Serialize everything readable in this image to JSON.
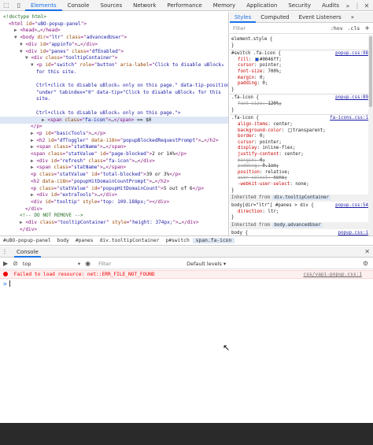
{
  "toolbar": {
    "tabs": [
      "Elements",
      "Console",
      "Sources",
      "Network",
      "Performance",
      "Memory",
      "Application",
      "Security",
      "Audits"
    ],
    "more": "»",
    "menu": "⋮",
    "close": "✕"
  },
  "elements": {
    "lines": [
      {
        "parts": [
          [
            "cm",
            "<!doctype html>"
          ]
        ]
      },
      {
        "parts": [
          [
            "t",
            "<html "
          ],
          [
            "a",
            "id"
          ],
          [
            "t",
            "=\""
          ],
          [
            "v",
            "uBO-popup-panel"
          ],
          [
            "t",
            "\">"
          ]
        ]
      },
      {
        "parts": [
          [
            "tri",
            "▶ "
          ],
          [
            "t",
            "<head>"
          ],
          [
            "tx",
            "…"
          ],
          [
            "t",
            "</head>"
          ]
        ]
      },
      {
        "parts": [
          [
            "tri",
            "▼ "
          ],
          [
            "t",
            "<body "
          ],
          [
            "a",
            "dir"
          ],
          [
            "t",
            "=\""
          ],
          [
            "v",
            "ltr"
          ],
          [
            "t",
            "\" "
          ],
          [
            "a",
            "class"
          ],
          [
            "t",
            "=\""
          ],
          [
            "v",
            "advancedUser"
          ],
          [
            "t",
            "\">"
          ]
        ]
      },
      {
        "parts": [
          [
            "tri",
            "▼ "
          ],
          [
            "t",
            "<div "
          ],
          [
            "a",
            "id"
          ],
          [
            "t",
            "=\""
          ],
          [
            "v",
            "appinfo"
          ],
          [
            "t",
            "\">"
          ],
          [
            "tx",
            "…"
          ],
          [
            "t",
            "</div>"
          ]
        ]
      },
      {
        "parts": [
          [
            "tri",
            "▼ "
          ],
          [
            "t",
            "<div "
          ],
          [
            "a",
            "id"
          ],
          [
            "t",
            "=\""
          ],
          [
            "v",
            "panes"
          ],
          [
            "t",
            "\" "
          ],
          [
            "a",
            "class"
          ],
          [
            "t",
            "=\""
          ],
          [
            "v",
            "dfEnabled"
          ],
          [
            "t",
            "\">"
          ]
        ]
      },
      {
        "parts": [
          [
            "tri",
            "▼ "
          ],
          [
            "t",
            "<div "
          ],
          [
            "a",
            "class"
          ],
          [
            "t",
            "=\""
          ],
          [
            "v",
            "tooltipContainer"
          ],
          [
            "t",
            "\">"
          ]
        ]
      },
      {
        "parts": [
          [
            "tri",
            "▼ "
          ],
          [
            "t",
            "<p "
          ],
          [
            "a",
            "id"
          ],
          [
            "t",
            "=\""
          ],
          [
            "v",
            "switch"
          ],
          [
            "t",
            "\" "
          ],
          [
            "a",
            "role"
          ],
          [
            "t",
            "=\""
          ],
          [
            "v",
            "button"
          ],
          [
            "t",
            "\" "
          ],
          [
            "a",
            "aria-label"
          ],
          [
            "t",
            "=\""
          ],
          [
            "v",
            "Click to disable uBlock₀"
          ]
        ]
      },
      {
        "parts": [
          [
            "v",
            "for this site."
          ]
        ]
      },
      {
        "parts": []
      },
      {
        "parts": [
          [
            "v",
            "Ctrl+click to disable uBlock₀ only on this page.\" data-tip-position="
          ]
        ]
      },
      {
        "parts": [
          [
            "v",
            "\"under\" tabindex=\"0\" data-tip=\"Click to disable uBlock₀ for this"
          ]
        ]
      },
      {
        "parts": [
          [
            "v",
            "site."
          ]
        ]
      },
      {
        "parts": []
      },
      {
        "parts": [
          [
            "v",
            "Ctrl+click to disable uBlock₀ only on this page.\">"
          ]
        ]
      },
      {
        "parts": [
          [
            "tri",
            "▶ "
          ],
          [
            "t",
            "<span "
          ],
          [
            "a",
            "class"
          ],
          [
            "t",
            "=\""
          ],
          [
            "v",
            "fa-icon"
          ],
          [
            "t",
            "\">"
          ],
          [
            "tx",
            "…"
          ],
          [
            "t",
            "</span>"
          ],
          [
            "tx",
            " == $0"
          ]
        ],
        "sel": true
      },
      {
        "parts": [
          [
            "t",
            "</p>"
          ]
        ]
      },
      {
        "parts": [
          [
            "tri",
            "▶ "
          ],
          [
            "t",
            "<p "
          ],
          [
            "a",
            "id"
          ],
          [
            "t",
            "=\""
          ],
          [
            "v",
            "basicTools"
          ],
          [
            "t",
            "\">"
          ],
          [
            "tx",
            "…"
          ],
          [
            "t",
            "</p>"
          ]
        ]
      },
      {
        "parts": [
          [
            "tri",
            "▶ "
          ],
          [
            "t",
            "<h2 "
          ],
          [
            "a",
            "id"
          ],
          [
            "t",
            "=\""
          ],
          [
            "v",
            "dfToggler"
          ],
          [
            "t",
            "\" "
          ],
          [
            "a",
            "data-i18n"
          ],
          [
            "t",
            "=\""
          ],
          [
            "v",
            "popupBlockedRequestPrompt"
          ],
          [
            "t",
            "\">"
          ],
          [
            "tx",
            "…"
          ],
          [
            "t",
            "</h2>"
          ]
        ]
      },
      {
        "parts": [
          [
            "tri",
            "▶ "
          ],
          [
            "t",
            "<span "
          ],
          [
            "a",
            "class"
          ],
          [
            "t",
            "=\""
          ],
          [
            "v",
            "statName"
          ],
          [
            "t",
            "\">"
          ],
          [
            "tx",
            "…"
          ],
          [
            "t",
            "</span>"
          ]
        ]
      },
      {
        "parts": [
          [
            "t",
            "<span "
          ],
          [
            "a",
            "class"
          ],
          [
            "t",
            "=\""
          ],
          [
            "v",
            "statValue"
          ],
          [
            "t",
            "\" "
          ],
          [
            "a",
            "id"
          ],
          [
            "t",
            "=\""
          ],
          [
            "v",
            "page-blocked"
          ],
          [
            "t",
            "\">"
          ],
          [
            "tx",
            "2 or 14%"
          ],
          [
            "t",
            "</p>"
          ]
        ]
      },
      {
        "parts": [
          [
            "tri",
            "▶ "
          ],
          [
            "t",
            "<div "
          ],
          [
            "a",
            "id"
          ],
          [
            "t",
            "=\""
          ],
          [
            "v",
            "refresh"
          ],
          [
            "t",
            "\" "
          ],
          [
            "a",
            "class"
          ],
          [
            "t",
            "=\""
          ],
          [
            "v",
            "fa-icon"
          ],
          [
            "t",
            "\">"
          ],
          [
            "tx",
            "…"
          ],
          [
            "t",
            "</div>"
          ]
        ]
      },
      {
        "parts": [
          [
            "tri",
            "▶ "
          ],
          [
            "t",
            "<span "
          ],
          [
            "a",
            "class"
          ],
          [
            "t",
            "=\""
          ],
          [
            "v",
            "statName"
          ],
          [
            "t",
            "\">"
          ],
          [
            "tx",
            "…"
          ],
          [
            "t",
            "</span>"
          ]
        ]
      },
      {
        "parts": [
          [
            "t",
            "<p "
          ],
          [
            "a",
            "class"
          ],
          [
            "t",
            "=\""
          ],
          [
            "v",
            "statValue"
          ],
          [
            "t",
            "\" "
          ],
          [
            "a",
            "id"
          ],
          [
            "t",
            "=\""
          ],
          [
            "v",
            "total-blocked"
          ],
          [
            "t",
            "\">"
          ],
          [
            "tx",
            "39 or 3%"
          ],
          [
            "t",
            "</p>"
          ]
        ]
      },
      {
        "parts": [
          [
            "t",
            "<h2 "
          ],
          [
            "a",
            "data-i18n"
          ],
          [
            "t",
            "=\""
          ],
          [
            "v",
            "popupHitDomainCountPrompt"
          ],
          [
            "t",
            "\">"
          ],
          [
            "tx",
            "…"
          ],
          [
            "t",
            "</h2>"
          ]
        ]
      },
      {
        "parts": [
          [
            "t",
            "<p "
          ],
          [
            "a",
            "class"
          ],
          [
            "t",
            "=\""
          ],
          [
            "v",
            "statValue"
          ],
          [
            "t",
            "\" "
          ],
          [
            "a",
            "id"
          ],
          [
            "t",
            "=\""
          ],
          [
            "v",
            "popupHitDomainCount"
          ],
          [
            "t",
            "\">"
          ],
          [
            "tx",
            "5 out of 6"
          ],
          [
            "t",
            "</p>"
          ]
        ]
      },
      {
        "parts": [
          [
            "tri",
            "▶ "
          ],
          [
            "t",
            "<div "
          ],
          [
            "a",
            "id"
          ],
          [
            "t",
            "=\""
          ],
          [
            "v",
            "extraTools"
          ],
          [
            "t",
            "\">"
          ],
          [
            "tx",
            "…"
          ],
          [
            "t",
            "</div>"
          ]
        ]
      },
      {
        "parts": [
          [
            "t",
            "<div "
          ],
          [
            "a",
            "id"
          ],
          [
            "t",
            "=\""
          ],
          [
            "v",
            "tooltip"
          ],
          [
            "t",
            "\" "
          ],
          [
            "a",
            "style"
          ],
          [
            "t",
            "=\""
          ],
          [
            "v",
            "top: 109.188px;"
          ],
          [
            "t",
            "\">"
          ],
          [
            "t",
            "</div>"
          ]
        ]
      },
      {
        "parts": [
          [
            "t",
            "</div>"
          ]
        ]
      },
      {
        "parts": [
          [
            "cm",
            "<!-- DO NOT REMOVE -->"
          ]
        ]
      },
      {
        "parts": [
          [
            "tri",
            "▶ "
          ],
          [
            "t",
            "<div "
          ],
          [
            "a",
            "class"
          ],
          [
            "t",
            "=\""
          ],
          [
            "v",
            "tooltipContainer"
          ],
          [
            "t",
            "\" "
          ],
          [
            "a",
            "style"
          ],
          [
            "t",
            "=\""
          ],
          [
            "v",
            "height: 374px;"
          ],
          [
            "t",
            "\">"
          ],
          [
            "tx",
            "…"
          ],
          [
            "t",
            "</div>"
          ]
        ]
      },
      {
        "parts": [
          [
            "t",
            "</div>"
          ]
        ]
      }
    ],
    "indents": [
      0,
      1,
      2,
      2,
      3,
      3,
      4,
      5,
      6,
      6,
      6,
      6,
      6,
      6,
      6,
      7,
      5,
      5,
      5,
      5,
      5,
      5,
      5,
      5,
      5,
      5,
      5,
      5,
      4,
      3,
      3,
      3
    ]
  },
  "styles": {
    "tabs": [
      "Styles",
      "Computed",
      "Event Listeners",
      "»"
    ],
    "filter_placeholder": "Filter",
    "hov": ":hov",
    "cls": ".cls",
    "plus": "+",
    "lines": [
      {
        "kind": "sel",
        "text": "element.style {",
        "top": 0
      },
      {
        "kind": "sel",
        "text": "}",
        "top": 1
      },
      {
        "kind": "div",
        "top": 2.2
      },
      {
        "kind": "sel",
        "text": "#switch .fa-icon {",
        "src": "popup.css:98",
        "top": 2.4
      },
      {
        "kind": "prop",
        "p": "fill",
        "v": "#0046ff;",
        "swatch": "#0046ff",
        "top": 3.4
      },
      {
        "kind": "prop",
        "p": "cursor",
        "v": "pointer;",
        "top": 4.4
      },
      {
        "kind": "prop",
        "p": "font-size",
        "v": "700%;",
        "top": 5.4
      },
      {
        "kind": "prop",
        "p": "margin",
        "v": "0;",
        "top": 6.4
      },
      {
        "kind": "prop",
        "p": "padding",
        "v": "0;",
        "top": 7.4
      },
      {
        "kind": "sel",
        "text": "}",
        "top": 8.4
      },
      {
        "kind": "div",
        "top": 9.6
      },
      {
        "kind": "sel",
        "text": ".fa-icon {",
        "src": "popup.css:89",
        "top": 9.8
      },
      {
        "kind": "strike",
        "p": "font-size",
        "v": "120%;",
        "top": 10.8
      },
      {
        "kind": "sel",
        "text": "}",
        "top": 11.8
      },
      {
        "kind": "div",
        "top": 13.0
      },
      {
        "kind": "sel",
        "text": ".fa-icon {",
        "src": "fa-icons.css:1",
        "top": 13.2
      },
      {
        "kind": "prop",
        "p": "align-items",
        "v": "center;",
        "top": 14.2
      },
      {
        "kind": "prop",
        "p": "background-color",
        "v": "transparent;",
        "swatch": "#ffffff",
        "top": 15.2
      },
      {
        "kind": "prop",
        "p": "border",
        "v": "0;",
        "top": 16.2
      },
      {
        "kind": "prop",
        "p": "cursor",
        "v": "pointer;",
        "top": 17.2
      },
      {
        "kind": "prop",
        "p": "display",
        "v": "inline-flex;",
        "top": 18.2
      },
      {
        "kind": "prop",
        "p": "justify-content",
        "v": "center;",
        "top": 19.2
      },
      {
        "kind": "strike",
        "p": "margin",
        "v": "0;",
        "top": 20.2
      },
      {
        "kind": "strike",
        "p": "padding",
        "v": "0.1em;",
        "top": 21.2
      },
      {
        "kind": "prop",
        "p": "position",
        "v": "relative;",
        "top": 22.2
      },
      {
        "kind": "strike",
        "p": "user-select",
        "v": "none;",
        "top": 23.2
      },
      {
        "kind": "prop",
        "p": "-webkit-user-select",
        "v": "none;",
        "top": 24.2
      },
      {
        "kind": "sel",
        "text": "}",
        "top": 25.2
      },
      {
        "kind": "inh",
        "text": "Inherited from ",
        "badge": "div.tooltipContainer",
        "top": 26.5
      },
      {
        "kind": "sel",
        "text": "body[dir=\"ltr\"] #panes > div {",
        "src": "popup.css:54",
        "top": 27.8
      },
      {
        "kind": "prop",
        "p": "direction",
        "v": "ltr;",
        "top": 28.8
      },
      {
        "kind": "sel",
        "text": "}",
        "top": 29.8
      },
      {
        "kind": "inh",
        "text": "Inherited from ",
        "badge": "body.advancedUser",
        "top": 31.1
      },
      {
        "kind": "sel",
        "text": "body {",
        "src": "popup.css:1",
        "top": 32.4
      }
    ]
  },
  "breadcrumb": [
    "#uBO-popup-panel",
    "body",
    "#panes",
    "div.tooltipContainer",
    "p#switch",
    "span.fa-icon"
  ],
  "console": {
    "title": "Console",
    "context": "top",
    "filter_placeholder": "Filter",
    "levels": "Default levels ▾",
    "error": "Failed to load resource: net::ERR_FILE_NOT_FOUND",
    "error_source": "css/vapi-popup.css:1",
    "prompt": ">"
  },
  "colors": {
    "accent": "#1a73e8",
    "selection": "#dde6f4",
    "error": "#ee0000"
  }
}
